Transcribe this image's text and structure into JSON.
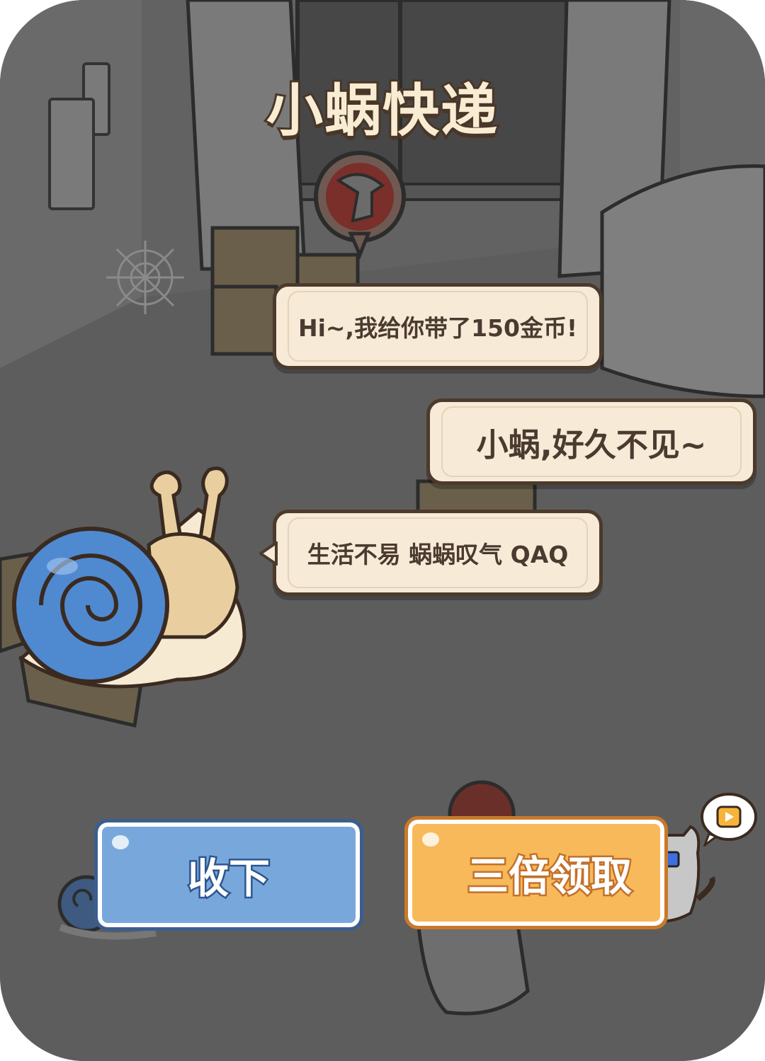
{
  "title": "小蜗快递",
  "dialog": {
    "line1": "Hi~,我给你带了150金币!",
    "line2": "小蜗,好久不见~",
    "line3": "生活不易 蜗蜗叹气 QAQ"
  },
  "buttons": {
    "accept_label": "收下",
    "triple_label": "三倍领取"
  },
  "icons": [
    "snail-character",
    "video-ad-icon",
    "cat-3d-glasses-icon",
    "mushroom-icon",
    "cardboard-box"
  ],
  "colors": {
    "accent_blue": "#78a8db",
    "accent_orange": "#f7b95a",
    "bubble_bg": "#f7ead6",
    "outline": "#4c3a2c"
  }
}
